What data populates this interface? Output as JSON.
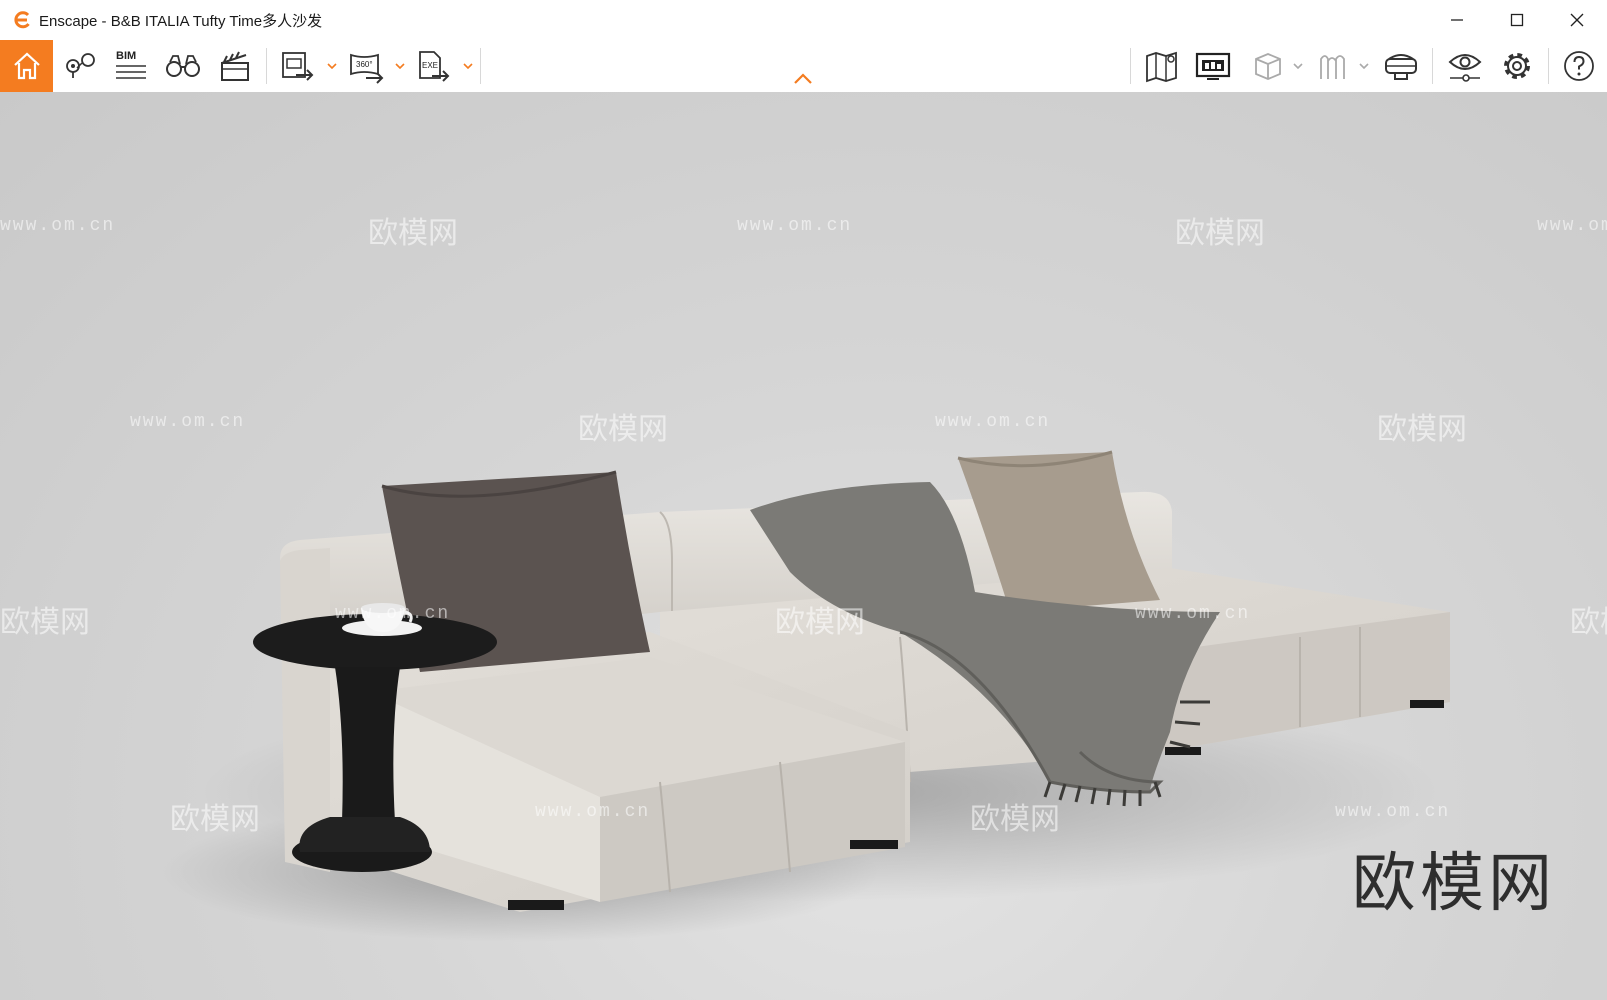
{
  "window": {
    "app_name": "Enscape",
    "title": "Enscape - B&B ITALIA Tufty Time多人沙发"
  },
  "toolbar": {
    "bim_label": "BIM",
    "pano_label": "360°",
    "exe_label": "EXE",
    "accent_color": "#f47c20"
  },
  "watermark": {
    "url_text": "www.om.cn",
    "brand_text": "欧模网",
    "large_text": "欧模网"
  },
  "icons": [
    "home-icon",
    "location-pin-icon",
    "bim-icon",
    "binoculars-icon",
    "clapperboard-icon",
    "screenshot-export-icon",
    "panorama-export-icon",
    "exe-export-icon",
    "map-icon",
    "monitor-icon",
    "cube-icon",
    "asset-library-icon",
    "vr-headset-icon",
    "eye-settings-icon",
    "gear-icon",
    "help-icon"
  ]
}
